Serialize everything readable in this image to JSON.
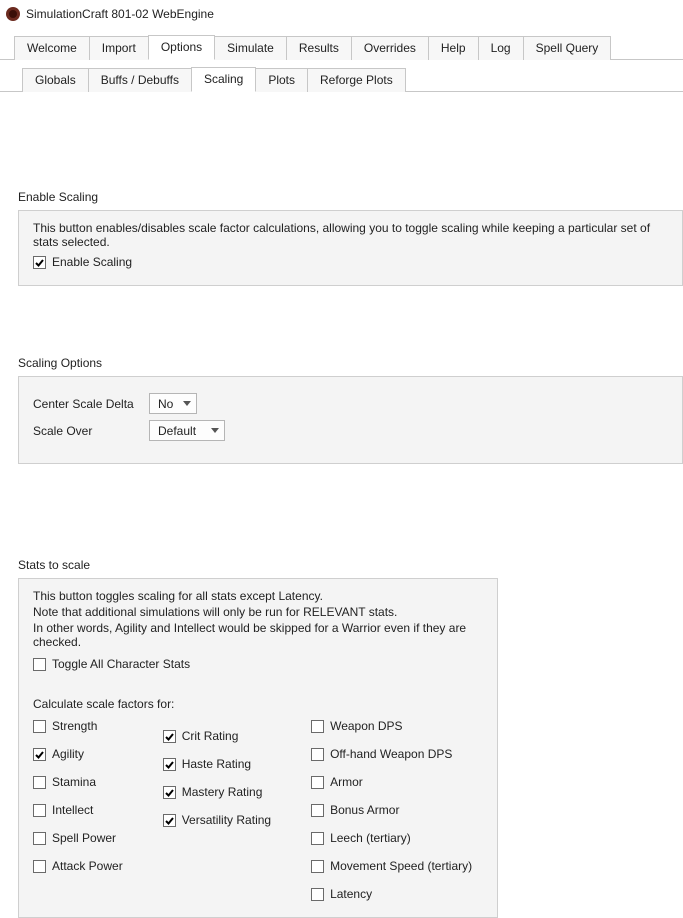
{
  "window": {
    "title": "SimulationCraft 801-02 WebEngine"
  },
  "tabs": {
    "main": [
      "Welcome",
      "Import",
      "Options",
      "Simulate",
      "Results",
      "Overrides",
      "Help",
      "Log",
      "Spell Query"
    ],
    "main_active": "Options",
    "sub": [
      "Globals",
      "Buffs / Debuffs",
      "Scaling",
      "Plots",
      "Reforge Plots"
    ],
    "sub_active": "Scaling"
  },
  "enable_scaling": {
    "heading": "Enable Scaling",
    "desc": "This button enables/disables scale factor calculations, allowing you to toggle scaling while keeping a particular set of stats selected.",
    "cb_label": "Enable Scaling",
    "cb_checked": true
  },
  "scaling_options": {
    "heading": "Scaling Options",
    "center_label": "Center Scale Delta",
    "center_value": "No",
    "scale_over_label": "Scale Over",
    "scale_over_value": "Default"
  },
  "stats": {
    "heading": "Stats to scale",
    "desc1": "This button toggles scaling for all stats except Latency.",
    "desc2": "Note that additional simulations will only be run for RELEVANT stats.",
    "desc3": "In other words, Agility and Intellect would be skipped for a Warrior even if they are checked.",
    "toggle_all_label": "Toggle All Character Stats",
    "toggle_all_checked": false,
    "calc_heading": "Calculate scale factors for:",
    "col1": [
      {
        "label": "Strength",
        "checked": false
      },
      {
        "label": "Agility",
        "checked": true
      },
      {
        "label": "Stamina",
        "checked": false
      },
      {
        "label": "Intellect",
        "checked": false
      },
      {
        "label": "Spell Power",
        "checked": false
      },
      {
        "label": "Attack Power",
        "checked": false
      }
    ],
    "col2": [
      {
        "label": "Crit Rating",
        "checked": true
      },
      {
        "label": "Haste Rating",
        "checked": true
      },
      {
        "label": "Mastery Rating",
        "checked": true
      },
      {
        "label": "Versatility Rating",
        "checked": true
      }
    ],
    "col3": [
      {
        "label": "Weapon DPS",
        "checked": false
      },
      {
        "label": "Off-hand Weapon DPS",
        "checked": false
      },
      {
        "label": "Armor",
        "checked": false
      },
      {
        "label": "Bonus Armor",
        "checked": false
      },
      {
        "label": "Leech (tertiary)",
        "checked": false
      },
      {
        "label": "Movement Speed (tertiary)",
        "checked": false
      },
      {
        "label": "Latency",
        "checked": false
      }
    ]
  }
}
